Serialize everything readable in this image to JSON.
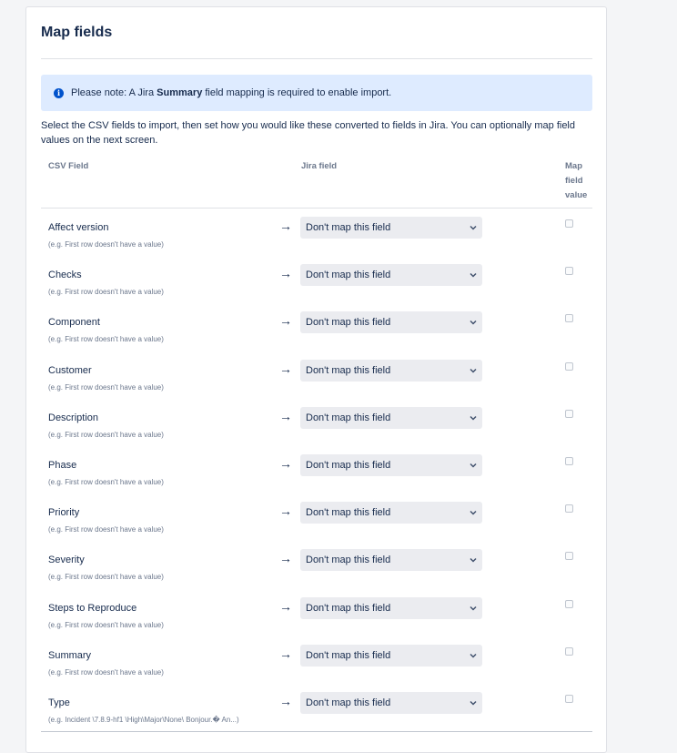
{
  "page": {
    "title": "Map fields"
  },
  "notice": {
    "prefix": "Please note: A Jira ",
    "bold": "Summary",
    "suffix": " field mapping is required to enable import."
  },
  "intro": "Select the CSV fields to import, then set how you would like these converted to fields in Jira. You can optionally map field values on the next screen.",
  "columns": {
    "csv": "CSV Field",
    "jira": "Jira field",
    "map_line1": "Map",
    "map_line2": "field",
    "map_line3": "value"
  },
  "arrow": "→",
  "select_default": "Don't map this field",
  "rows": [
    {
      "name": "Affect version",
      "example": "(e.g. First row doesn't have a value)"
    },
    {
      "name": "Checks",
      "example": "(e.g. First row doesn't have a value)"
    },
    {
      "name": "Component",
      "example": "(e.g. First row doesn't have a value)"
    },
    {
      "name": "Customer",
      "example": "(e.g. First row doesn't have a value)"
    },
    {
      "name": "Description",
      "example": "(e.g. First row doesn't have a value)"
    },
    {
      "name": "Phase",
      "example": "(e.g. First row doesn't have a value)"
    },
    {
      "name": "Priority",
      "example": "(e.g. First row doesn't have a value)"
    },
    {
      "name": "Severity",
      "example": "(e.g. First row doesn't have a value)"
    },
    {
      "name": "Steps to Reproduce",
      "example": "(e.g. First row doesn't have a value)"
    },
    {
      "name": "Summary",
      "example": "(e.g. First row doesn't have a value)"
    },
    {
      "name": "Type",
      "example": "(e.g. Incident \\7.8.9-hf1 \\High\\Major\\None\\ Bonjour.� An...)"
    }
  ],
  "colors": {
    "accent": "#0052cc",
    "notice_bg": "#deebff",
    "select_bg": "#ebecf0"
  }
}
